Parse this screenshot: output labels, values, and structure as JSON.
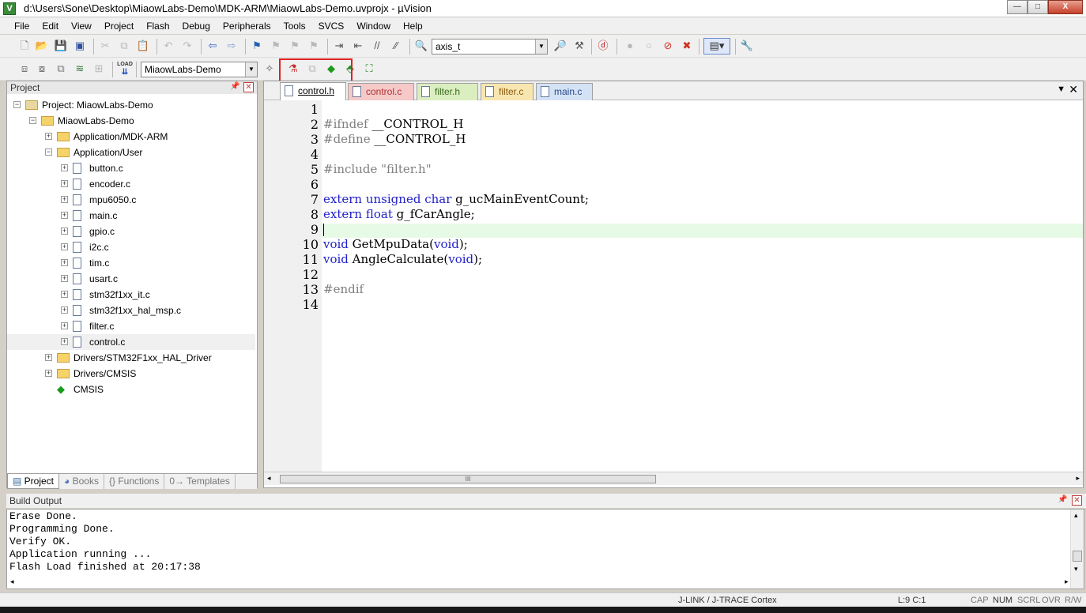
{
  "window": {
    "title": "d:\\Users\\Sone\\Desktop\\MiaowLabs-Demo\\MDK-ARM\\MiaowLabs-Demo.uvprojx - µVision",
    "app_icon": "V",
    "min": "—",
    "max": "□",
    "close": "X"
  },
  "menu": [
    "File",
    "Edit",
    "View",
    "Project",
    "Flash",
    "Debug",
    "Peripherals",
    "Tools",
    "SVCS",
    "Window",
    "Help"
  ],
  "toolbar1": {
    "find_value": "axis_t"
  },
  "toolbar2": {
    "target_value": "MiaowLabs-Demo",
    "load_label": "LOAD"
  },
  "project": {
    "header": "Project",
    "tree": [
      {
        "label": "Project: MiaowLabs-Demo",
        "type": "root",
        "indent": 0,
        "expander": "−"
      },
      {
        "label": "MiaowLabs-Demo",
        "type": "folder",
        "indent": 1,
        "expander": "−"
      },
      {
        "label": "Application/MDK-ARM",
        "type": "folder",
        "indent": 2,
        "expander": "+"
      },
      {
        "label": "Application/User",
        "type": "folder",
        "indent": 2,
        "expander": "−"
      },
      {
        "label": "button.c",
        "type": "file",
        "indent": 3,
        "expander": "+"
      },
      {
        "label": "encoder.c",
        "type": "file",
        "indent": 3,
        "expander": "+"
      },
      {
        "label": "mpu6050.c",
        "type": "file",
        "indent": 3,
        "expander": "+"
      },
      {
        "label": "main.c",
        "type": "file",
        "indent": 3,
        "expander": "+"
      },
      {
        "label": "gpio.c",
        "type": "file",
        "indent": 3,
        "expander": "+"
      },
      {
        "label": "i2c.c",
        "type": "file",
        "indent": 3,
        "expander": "+"
      },
      {
        "label": "tim.c",
        "type": "file",
        "indent": 3,
        "expander": "+"
      },
      {
        "label": "usart.c",
        "type": "file",
        "indent": 3,
        "expander": "+"
      },
      {
        "label": "stm32f1xx_it.c",
        "type": "file",
        "indent": 3,
        "expander": "+"
      },
      {
        "label": "stm32f1xx_hal_msp.c",
        "type": "file",
        "indent": 3,
        "expander": "+"
      },
      {
        "label": "filter.c",
        "type": "file",
        "indent": 3,
        "expander": "+"
      },
      {
        "label": "control.c",
        "type": "file",
        "indent": 3,
        "expander": "+",
        "selected": true
      },
      {
        "label": "Drivers/STM32F1xx_HAL_Driver",
        "type": "folder",
        "indent": 2,
        "expander": "+"
      },
      {
        "label": "Drivers/CMSIS",
        "type": "folder",
        "indent": 2,
        "expander": "+"
      },
      {
        "label": "CMSIS",
        "type": "cmsis",
        "indent": 2,
        "expander": ""
      }
    ],
    "tabs": [
      "Project",
      "Books",
      "{} Functions",
      "0→ Templates"
    ]
  },
  "editor": {
    "tabs": [
      {
        "label": "control.h",
        "color": "#dccbf0",
        "active": true
      },
      {
        "label": "control.c",
        "color": "#f6c9c9",
        "active": false
      },
      {
        "label": "filter.h",
        "color": "#dbeec0",
        "active": false
      },
      {
        "label": "filter.c",
        "color": "#f8e6b0",
        "active": false
      },
      {
        "label": "main.c",
        "color": "#d4e2f6",
        "active": false
      }
    ],
    "line_numbers": [
      "1",
      "2",
      "3",
      "4",
      "5",
      "6",
      "7",
      "8",
      "9",
      "10",
      "11",
      "12",
      "13",
      "14"
    ],
    "lines": [
      {
        "parts": []
      },
      {
        "parts": [
          {
            "t": "#ifndef",
            "c": "pp"
          },
          {
            "t": " __CONTROL_H",
            "c": ""
          }
        ]
      },
      {
        "parts": [
          {
            "t": "#define",
            "c": "pp"
          },
          {
            "t": " __CONTROL_H",
            "c": ""
          }
        ]
      },
      {
        "parts": []
      },
      {
        "parts": [
          {
            "t": "#include",
            "c": "pp"
          },
          {
            "t": " ",
            "c": ""
          },
          {
            "t": "\"filter.h\"",
            "c": "str"
          }
        ]
      },
      {
        "parts": []
      },
      {
        "parts": [
          {
            "t": "extern",
            "c": "k"
          },
          {
            "t": " ",
            "c": ""
          },
          {
            "t": "unsigned",
            "c": "k"
          },
          {
            "t": " ",
            "c": ""
          },
          {
            "t": "char",
            "c": "k"
          },
          {
            "t": " g_ucMainEventCount;",
            "c": ""
          }
        ]
      },
      {
        "parts": [
          {
            "t": "extern",
            "c": "k"
          },
          {
            "t": " ",
            "c": ""
          },
          {
            "t": "float",
            "c": "k"
          },
          {
            "t": " g_fCarAngle;",
            "c": ""
          }
        ]
      },
      {
        "parts": []
      },
      {
        "parts": [
          {
            "t": "void",
            "c": "k"
          },
          {
            "t": " GetMpuData(",
            "c": ""
          },
          {
            "t": "void",
            "c": "k"
          },
          {
            "t": ");",
            "c": ""
          }
        ]
      },
      {
        "parts": [
          {
            "t": "void",
            "c": "k"
          },
          {
            "t": " AngleCalculate(",
            "c": ""
          },
          {
            "t": "void",
            "c": "k"
          },
          {
            "t": ");",
            "c": ""
          }
        ]
      },
      {
        "parts": []
      },
      {
        "parts": [
          {
            "t": "#endif",
            "c": "pp"
          }
        ]
      },
      {
        "parts": []
      }
    ],
    "scroll_grip": "III"
  },
  "build": {
    "header": "Build Output",
    "lines": [
      "Erase Done.",
      "Programming Done.",
      "Verify OK.",
      "Application running ...",
      "Flash Load finished at 20:17:38"
    ]
  },
  "status": {
    "debugger": "J-LINK / J-TRACE Cortex",
    "position": "L:9 C:1",
    "caps": "CAP",
    "num": "NUM",
    "scrl": "SCRL",
    "ovr": "OVR",
    "rw": "R/W"
  }
}
